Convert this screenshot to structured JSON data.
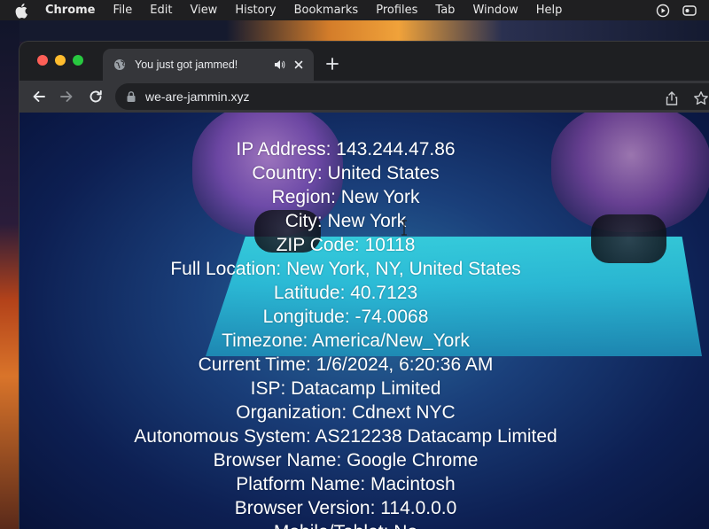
{
  "menubar": {
    "items": [
      "Chrome",
      "File",
      "Edit",
      "View",
      "History",
      "Bookmarks",
      "Profiles",
      "Tab",
      "Window",
      "Help"
    ]
  },
  "browser": {
    "tab_title": "You just got jammed!",
    "url": "we-are-jammin.xyz"
  },
  "page": {
    "lines": [
      "IP Address: 143.244.47.86",
      "Country: United States",
      "Region: New York",
      "City: New York",
      "ZIP Code: 10118",
      "Full Location: New York, NY, United States",
      "Latitude: 40.7123",
      "Longitude: -74.0068",
      "Timezone: America/New_York",
      "Current Time: 1/6/2024, 6:20:36 AM",
      "ISP: Datacamp Limited",
      "Organization: Cdnext NYC",
      "Autonomous System: AS212238 Datacamp Limited",
      "Browser Name: Google Chrome",
      "Platform Name: Macintosh",
      "Browser Version: 114.0.0.0",
      "Mobile/Tablet: No"
    ]
  },
  "colors": {
    "menubar_bg": "#1f1f21",
    "tab_bg": "#35363a",
    "omnibox_bg": "#202124",
    "text_white": "#ffffff"
  },
  "icons": [
    "apple-logo-icon",
    "globe-icon",
    "speaker-icon",
    "close-icon",
    "plus-icon",
    "back-arrow-icon",
    "forward-arrow-icon",
    "reload-icon",
    "lock-icon",
    "share-icon",
    "star-icon",
    "text-cursor-icon",
    "play-circle-icon",
    "control-center-icon"
  ]
}
